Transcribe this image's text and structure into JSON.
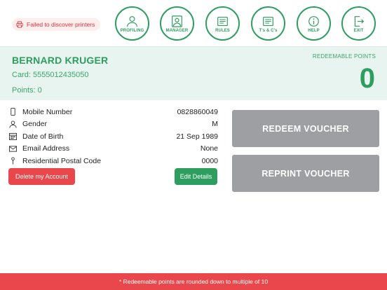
{
  "colors": {
    "brand_green": "#2e9e5f",
    "light_green_bg": "#e8f4ef",
    "danger_red": "#e9474b",
    "disabled_gray": "#9d9fa3"
  },
  "header": {
    "printer_status": "Failed to discover printers",
    "nav": [
      {
        "label": "PROFILING",
        "icon": "user-icon"
      },
      {
        "label": "MANAGER",
        "icon": "manager-icon"
      },
      {
        "label": "RULES",
        "icon": "rules-icon"
      },
      {
        "label": "T's & C's",
        "icon": "terms-icon"
      },
      {
        "label": "HELP",
        "icon": "info-icon"
      },
      {
        "label": "EXIT",
        "icon": "exit-icon"
      }
    ]
  },
  "customer": {
    "name": "BERNARD KRUGER",
    "card": "Card: 5555012435050",
    "points": "Points: 0",
    "redeemable_label": "REDEEMABLE POINTS",
    "redeemable_value": "0"
  },
  "details": [
    {
      "label": "Mobile Number",
      "value": "0828860049",
      "icon": "phone-icon"
    },
    {
      "label": "Gender",
      "value": "M",
      "icon": "person-icon"
    },
    {
      "label": "Date of Birth",
      "value": "21 Sep 1989",
      "icon": "calendar-icon"
    },
    {
      "label": "Email Address",
      "value": "None",
      "icon": "mail-icon"
    },
    {
      "label": "Residential Postal Code",
      "value": "0000",
      "icon": "pin-icon"
    }
  ],
  "actions": {
    "delete_label": "Delete my Account",
    "edit_label": "Edit Details",
    "redeem_label": "REDEEM VOUCHER",
    "reprint_label": "REPRINT VOUCHER"
  },
  "footer": {
    "note": "* Redeemable points are rounded down to multiple of 10"
  }
}
